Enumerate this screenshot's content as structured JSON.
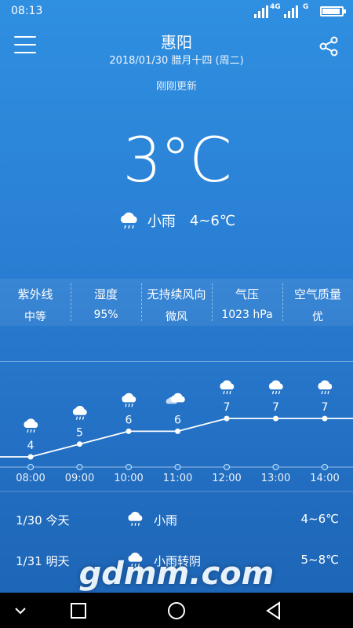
{
  "status": {
    "time": "08:13",
    "net1": "4G",
    "net2": "G"
  },
  "header": {
    "city": "惠阳",
    "date": "2018/01/30 腊月十四 (周二)",
    "updated": "刚刚更新"
  },
  "current": {
    "temp": "3°C",
    "condition": "小雨",
    "range": "4~6℃",
    "icon": "light-rain-cloud-icon"
  },
  "info": [
    {
      "label": "紫外线",
      "value": "中等"
    },
    {
      "label": "湿度",
      "value": "95%"
    },
    {
      "label": "无持续风向",
      "value": "微风"
    },
    {
      "label": "气压",
      "value": "1023 hPa"
    },
    {
      "label": "空气质量",
      "value": "优"
    }
  ],
  "chart_data": {
    "type": "line",
    "x": [
      "08:00",
      "09:00",
      "10:00",
      "11:00",
      "12:00",
      "13:00",
      "14:00"
    ],
    "values": [
      4,
      5,
      6,
      6,
      7,
      7,
      7
    ],
    "icons": [
      "rain",
      "rain",
      "rain",
      "cloud",
      "rain",
      "rain",
      "rain"
    ]
  },
  "daily": [
    {
      "date": "1/30 今天",
      "condition": "小雨",
      "range": "4~6℃"
    },
    {
      "date": "1/31 明天",
      "condition": "小雨转阴",
      "range": "5~8℃"
    }
  ],
  "watermark": "gdmm.com",
  "colors": {
    "background": "#2a7fd4",
    "nav": "#000000"
  }
}
